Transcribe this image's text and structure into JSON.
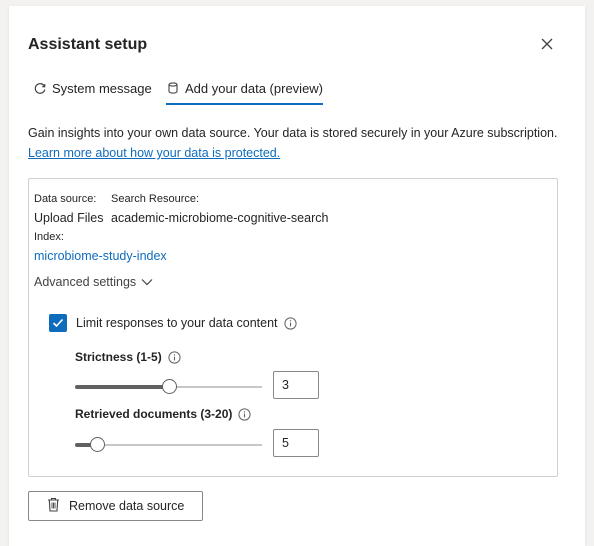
{
  "dialog": {
    "title": "Assistant setup",
    "close_icon": "close-icon"
  },
  "tabs": [
    {
      "label": "System message",
      "icon": "refresh-icon",
      "active": false
    },
    {
      "label": "Add your data (preview)",
      "icon": "database-icon",
      "active": true
    }
  ],
  "intro": {
    "text": "Gain insights into your own data source. Your data is stored securely in your Azure subscription.",
    "link": "Learn more about how your data is protected."
  },
  "data_source": {
    "source_label": "Data source:",
    "source_value": "Upload Files",
    "resource_label": "Search Resource:",
    "resource_value": "academic-microbiome-cognitive-search",
    "index_label": "Index:",
    "index_value": "microbiome-study-index"
  },
  "advanced": {
    "label": "Advanced settings",
    "limit_label": "Limit responses to your data content",
    "limit_checked": true,
    "strictness": {
      "label": "Strictness (1-5)",
      "value": "3",
      "min": 1,
      "max": 5
    },
    "retrieved": {
      "label": "Retrieved documents (3-20)",
      "value": "5",
      "min": 3,
      "max": 20
    }
  },
  "remove_button": {
    "label": "Remove data source",
    "icon": "trash-icon"
  },
  "colors": {
    "accent": "#0f6cbd",
    "link": "#0f6cbd",
    "slider": "#616161"
  }
}
